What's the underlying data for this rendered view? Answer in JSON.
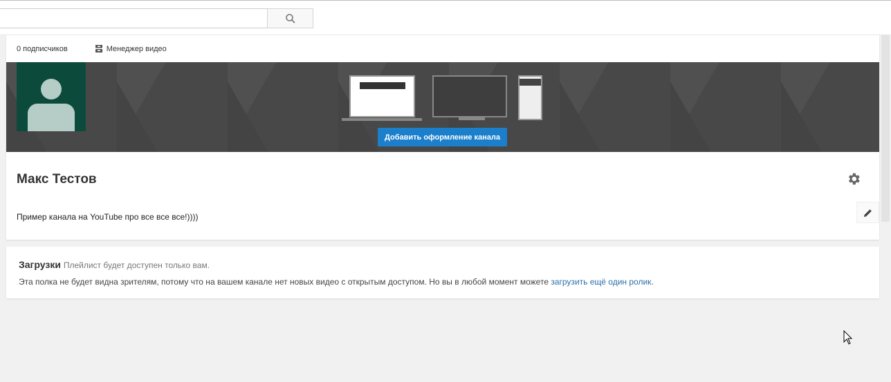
{
  "header": {
    "search_placeholder": "",
    "search_icon": "search-icon"
  },
  "channel": {
    "subscribers": "0 подписчиков",
    "video_manager": "Менеджер видео",
    "add_art_button": "Добавить оформление канала",
    "name": "Макс Тестов",
    "description": "Пример канала на YouTube про все все все!))))",
    "avatar_color": "#0c4a3c",
    "accent": "#1b7fcc"
  },
  "uploads": {
    "title": "Загрузки",
    "subtitle": "Плейлист будет доступен только вам.",
    "text": "Эта полка не будет видна зрителям, потому что на вашем канале нет новых видео с открытым доступом. Но вы в любой момент можете ",
    "link": "загрузить ещё один ролик",
    "end": "."
  }
}
